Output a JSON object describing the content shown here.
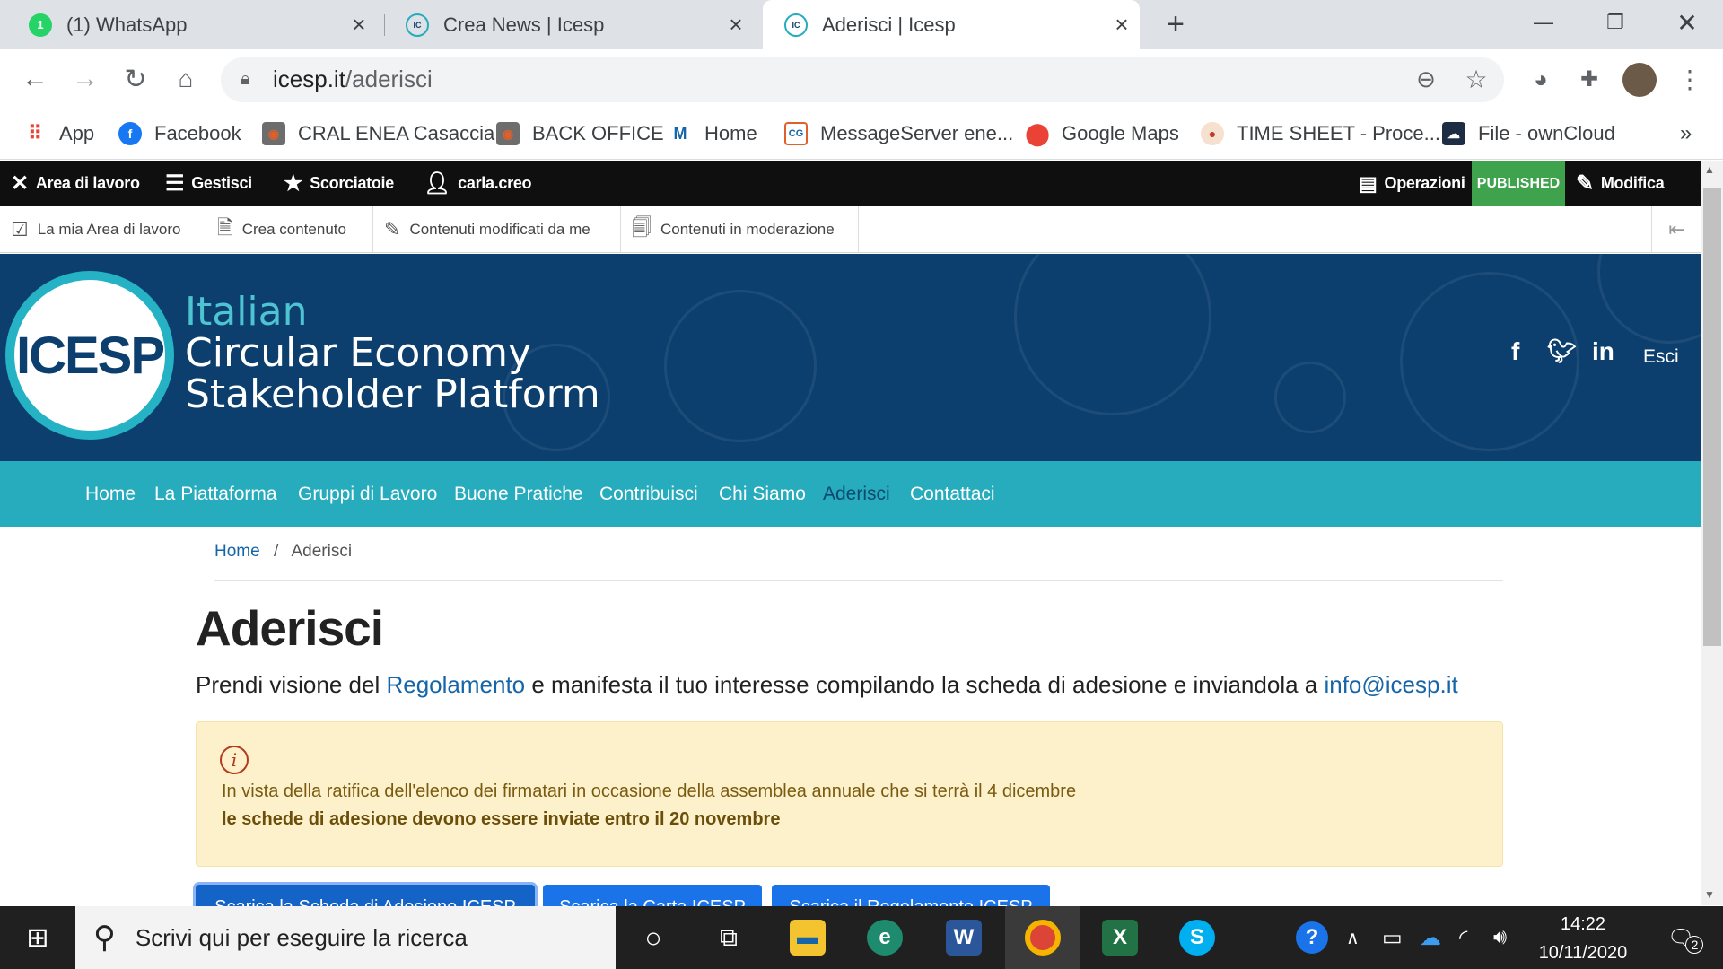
{
  "browser": {
    "tabs": [
      {
        "title": "(1) WhatsApp",
        "fav": "1"
      },
      {
        "title": "Crea News | Icesp",
        "fav": "IC"
      },
      {
        "title": "Aderisci | Icesp",
        "fav": "IC"
      }
    ],
    "url_host": "icesp.it",
    "url_path": "/aderisci",
    "bookmarks": [
      "App",
      "Facebook",
      "CRAL ENEA Casaccia",
      "BACK OFFICE",
      "Home",
      "MessageServer ene...",
      "Google Maps",
      "TIME SHEET - Proce...",
      "File - ownCloud"
    ],
    "more": "»"
  },
  "admin": {
    "area": "Area di lavoro",
    "manage": "Gestisci",
    "shortcuts": "Scorciatoie",
    "user": "carla.creo",
    "operations": "Operazioni",
    "status": "PUBLISHED",
    "edit": "Modifica",
    "tray": [
      "La mia Area di lavoro",
      "Crea contenuto",
      "Contenuti modificati da me",
      "Contenuti in moderazione"
    ]
  },
  "site": {
    "logo": "ICESP",
    "brand_line1": "Italian",
    "brand_line2": "Circular Economy",
    "brand_line3": "Stakeholder Platform",
    "logout": "Esci",
    "menu": [
      "Home",
      "La Piattaforma",
      "Gruppi di Lavoro",
      "Buone Pratiche",
      "Contribuisci",
      "Chi Siamo",
      "Aderisci",
      "Contattaci"
    ],
    "active_menu": "Aderisci"
  },
  "breadcrumb": {
    "home": "Home",
    "sep": "/",
    "current": "Aderisci"
  },
  "page": {
    "title": "Aderisci",
    "intro_pre": "Prendi visione del ",
    "intro_link": "Regolamento",
    "intro_mid": " e manifesta il tuo interesse compilando la scheda di adesione e inviandola a ",
    "intro_email": "info@icesp.it",
    "alert_line1": "In vista della ratifica dell'elenco dei firmatari in occasione della assemblea annuale che si terrà il 4 dicembre",
    "alert_line2": "le schede di adesione devono essere inviate entro il 20 novembre",
    "buttons": [
      "Scarica la Scheda di Adesione ICESP",
      "Scarica la Carta ICESP",
      "Scarica il Regolamento ICESP"
    ]
  },
  "taskbar": {
    "search_placeholder": "Scrivi qui per eseguire la ricerca",
    "time": "14:22",
    "date": "10/11/2020",
    "notifications": "2"
  },
  "colors": {
    "hero": "#0d3f6e",
    "menu": "#26acbd",
    "published": "#3fa34d",
    "link": "#1565a8"
  }
}
